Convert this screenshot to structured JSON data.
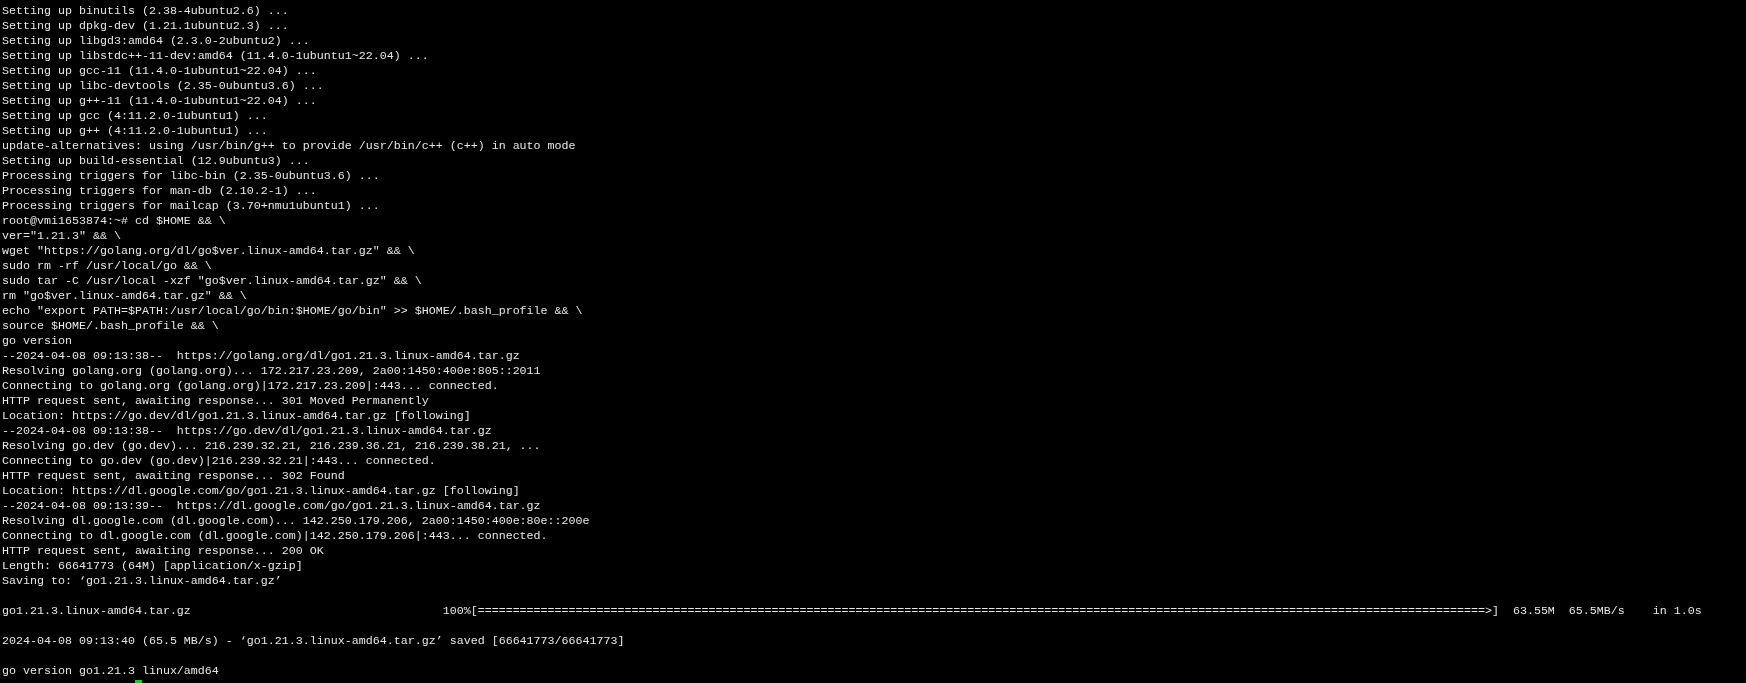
{
  "terminal": {
    "lines": [
      {
        "kind": "text",
        "text": "Setting up binutils (2.38-4ubuntu2.6) ..."
      },
      {
        "kind": "text",
        "text": "Setting up dpkg-dev (1.21.1ubuntu2.3) ..."
      },
      {
        "kind": "text",
        "text": "Setting up libgd3:amd64 (2.3.0-2ubuntu2) ..."
      },
      {
        "kind": "text",
        "text": "Setting up libstdc++-11-dev:amd64 (11.4.0-1ubuntu1~22.04) ..."
      },
      {
        "kind": "text",
        "text": "Setting up gcc-11 (11.4.0-1ubuntu1~22.04) ..."
      },
      {
        "kind": "text",
        "text": "Setting up libc-devtools (2.35-0ubuntu3.6) ..."
      },
      {
        "kind": "text",
        "text": "Setting up g++-11 (11.4.0-1ubuntu1~22.04) ..."
      },
      {
        "kind": "text",
        "text": "Setting up gcc (4:11.2.0-1ubuntu1) ..."
      },
      {
        "kind": "text",
        "text": "Setting up g++ (4:11.2.0-1ubuntu1) ..."
      },
      {
        "kind": "text",
        "text": "update-alternatives: using /usr/bin/g++ to provide /usr/bin/c++ (c++) in auto mode"
      },
      {
        "kind": "text",
        "text": "Setting up build-essential (12.9ubuntu3) ..."
      },
      {
        "kind": "text",
        "text": "Processing triggers for libc-bin (2.35-0ubuntu3.6) ..."
      },
      {
        "kind": "text",
        "text": "Processing triggers for man-db (2.10.2-1) ..."
      },
      {
        "kind": "text",
        "text": "Processing triggers for mailcap (3.70+nmu1ubuntu1) ..."
      },
      {
        "kind": "text",
        "text": "root@vmi1653874:~# cd $HOME && \\"
      },
      {
        "kind": "text",
        "text": "ver=\"1.21.3\" && \\"
      },
      {
        "kind": "text",
        "text": "wget \"https://golang.org/dl/go$ver.linux-amd64.tar.gz\" && \\"
      },
      {
        "kind": "text",
        "text": "sudo rm -rf /usr/local/go && \\"
      },
      {
        "kind": "text",
        "text": "sudo tar -C /usr/local -xzf \"go$ver.linux-amd64.tar.gz\" && \\"
      },
      {
        "kind": "text",
        "text": "rm \"go$ver.linux-amd64.tar.gz\" && \\"
      },
      {
        "kind": "text",
        "text": "echo \"export PATH=$PATH:/usr/local/go/bin:$HOME/go/bin\" >> $HOME/.bash_profile && \\"
      },
      {
        "kind": "text",
        "text": "source $HOME/.bash_profile && \\"
      },
      {
        "kind": "text",
        "text": "go version"
      },
      {
        "kind": "text",
        "text": "--2024-04-08 09:13:38--  https://golang.org/dl/go1.21.3.linux-amd64.tar.gz"
      },
      {
        "kind": "text",
        "text": "Resolving golang.org (golang.org)... 172.217.23.209, 2a00:1450:400e:805::2011"
      },
      {
        "kind": "text",
        "text": "Connecting to golang.org (golang.org)|172.217.23.209|:443... connected."
      },
      {
        "kind": "text",
        "text": "HTTP request sent, awaiting response... 301 Moved Permanently"
      },
      {
        "kind": "text",
        "text": "Location: https://go.dev/dl/go1.21.3.linux-amd64.tar.gz [following]"
      },
      {
        "kind": "text",
        "text": "--2024-04-08 09:13:38--  https://go.dev/dl/go1.21.3.linux-amd64.tar.gz"
      },
      {
        "kind": "text",
        "text": "Resolving go.dev (go.dev)... 216.239.32.21, 216.239.36.21, 216.239.38.21, ..."
      },
      {
        "kind": "text",
        "text": "Connecting to go.dev (go.dev)|216.239.32.21|:443... connected."
      },
      {
        "kind": "text",
        "text": "HTTP request sent, awaiting response... 302 Found"
      },
      {
        "kind": "text",
        "text": "Location: https://dl.google.com/go/go1.21.3.linux-amd64.tar.gz [following]"
      },
      {
        "kind": "text",
        "text": "--2024-04-08 09:13:39--  https://dl.google.com/go/go1.21.3.linux-amd64.tar.gz"
      },
      {
        "kind": "text",
        "text": "Resolving dl.google.com (dl.google.com)... 142.250.179.206, 2a00:1450:400e:80e::200e"
      },
      {
        "kind": "text",
        "text": "Connecting to dl.google.com (dl.google.com)|142.250.179.206|:443... connected."
      },
      {
        "kind": "text",
        "text": "HTTP request sent, awaiting response... 200 OK"
      },
      {
        "kind": "text",
        "text": "Length: 66641773 (64M) [application/x-gzip]"
      },
      {
        "kind": "text",
        "text": "Saving to: ‘go1.21.3.linux-amd64.tar.gz’"
      },
      {
        "kind": "blank"
      },
      {
        "kind": "text",
        "text": "go1.21.3.linux-amd64.tar.gz                                    100%[================================================================================================================================================>]  63.55M  65.5MB/s    in 1.0s"
      },
      {
        "kind": "blank"
      },
      {
        "kind": "text",
        "text": "2024-04-08 09:13:40 (65.5 MB/s) - ‘go1.21.3.linux-amd64.tar.gz’ saved [66641773/66641773]"
      },
      {
        "kind": "blank"
      },
      {
        "kind": "text",
        "text": "go version go1.21.3 linux/amd64"
      },
      {
        "kind": "cursor"
      }
    ]
  }
}
